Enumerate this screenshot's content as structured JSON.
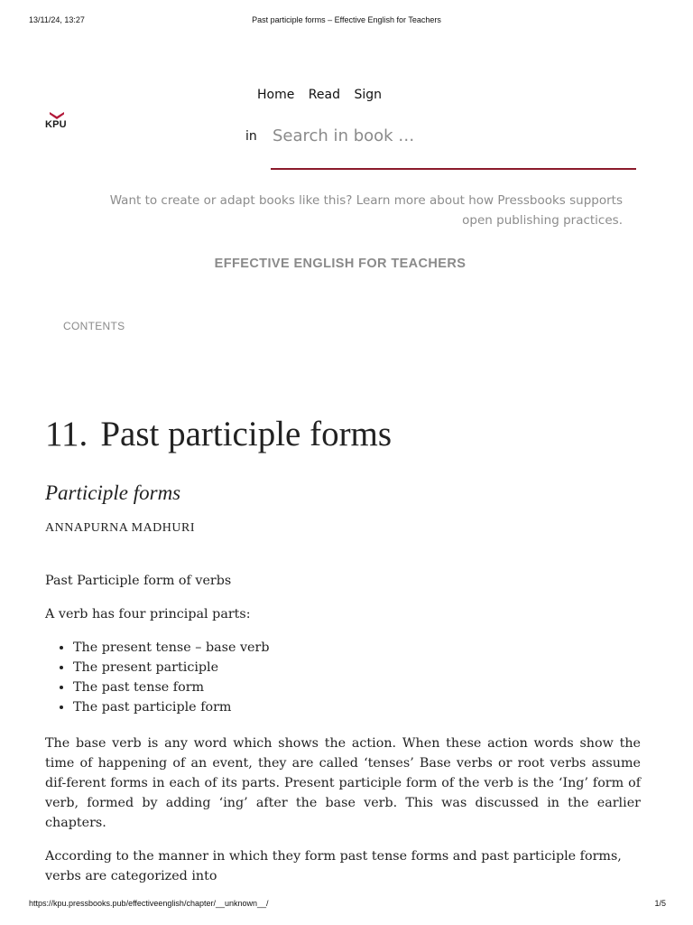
{
  "print_header": {
    "date": "13/11/24, 13:27",
    "title": "Past participle forms – Effective English for Teachers"
  },
  "print_footer": {
    "url": "https://kpu.pressbooks.pub/effectiveenglish/chapter/__unknown__/",
    "page": "1/5"
  },
  "logo": {
    "text": "KPU",
    "color": "#b3193a",
    "icon": "kpu-bird-logo-icon"
  },
  "nav": {
    "home": "Home",
    "read": "Read",
    "sign": "Sign"
  },
  "search": {
    "in_label": "in",
    "placeholder": "Search in book …",
    "value": "",
    "underline_color": "#8b1a2b"
  },
  "promo": {
    "line1": "Want to create or adapt books like this? Learn more about how Pressbooks supports",
    "line2": "open publishing practices."
  },
  "book_title": "EFFECTIVE ENGLISH FOR TEACHERS",
  "contents_label": "CONTENTS",
  "chapter": {
    "number": "11.",
    "title": "Past participle forms",
    "subtitle": "Participle forms",
    "author": "ANNAPURNA MADHURI"
  },
  "body": {
    "p1": "Past Participle form of verbs",
    "p2": "A verb has four principal parts:",
    "list": [
      "The present tense – base verb",
      "The present participle",
      "The past tense form",
      "The past participle form"
    ],
    "p3": "The base verb is any word which shows the action. When these action words show the time of happening of an event, they are called ‘tenses’ Base verbs or root verbs assume dif-ferent forms in each of its parts. Present participle form of the verb is the ‘Ing’ form of verb, formed by adding ‘ing’ after the base verb. This was discussed in the earlier chapters.",
    "p4": "According to the manner in which they form past tense forms and past participle forms, verbs are categorized into"
  }
}
